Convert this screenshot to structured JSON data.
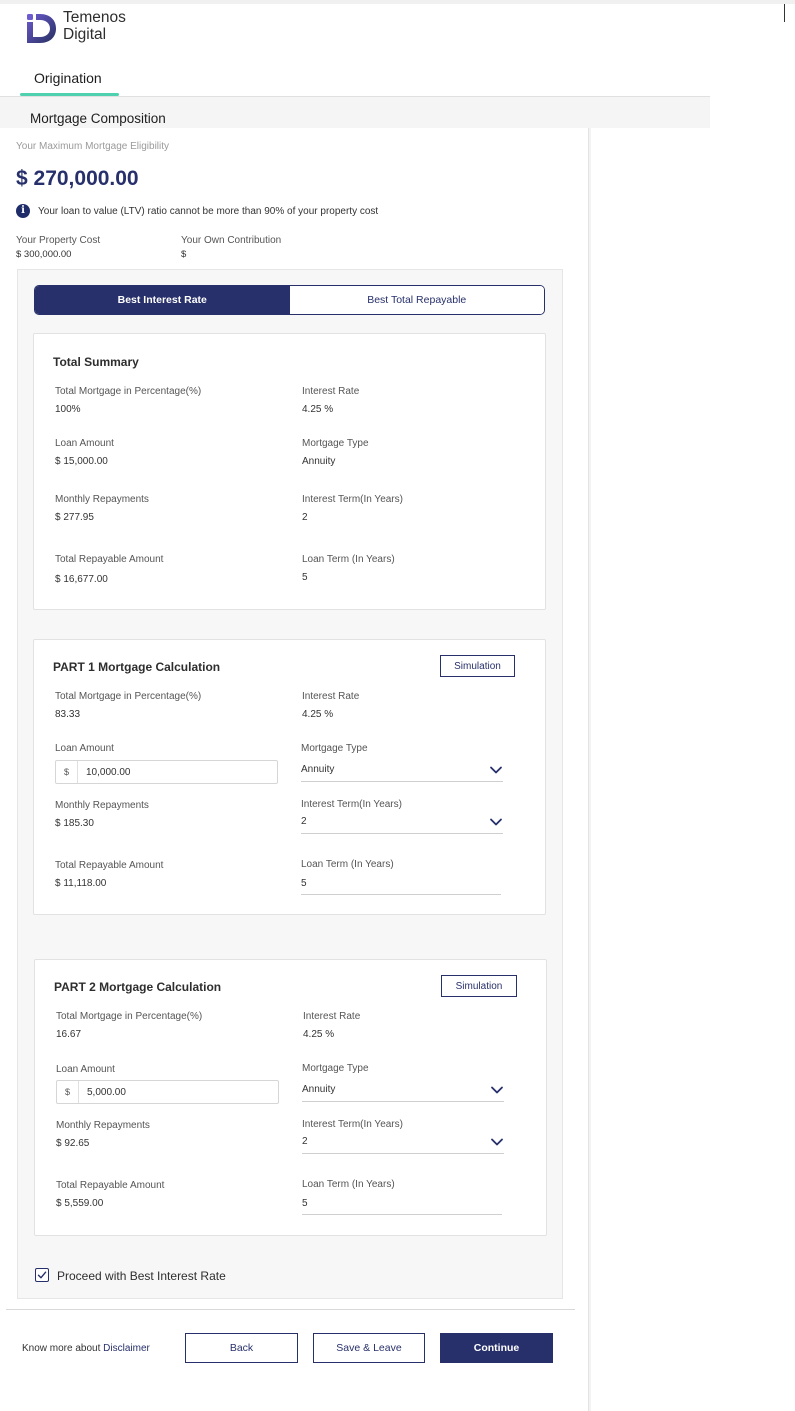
{
  "brand": {
    "name_line1": "Temenos",
    "name_line2": "Digital"
  },
  "nav": {
    "active_tab": "Origination"
  },
  "section": {
    "title": "Mortgage Composition"
  },
  "eligibility": {
    "label": "Your Maximum Mortgage Eligibility",
    "amount": "$ 270,000.00",
    "ltv_note": "Your loan to value (LTV) ratio cannot be more than 90% of your property cost",
    "property_cost_label": "Your Property Cost",
    "property_cost_value": "$ 300,000.00",
    "own_contribution_label": "Your Own Contribution",
    "own_contribution_value": "$"
  },
  "toggle": {
    "best_interest": "Best Interest Rate",
    "best_total": "Best Total Repayable"
  },
  "summary": {
    "title": "Total Summary",
    "total_pct_label": "Total Mortgage in Percentage(%)",
    "total_pct_value": "100%",
    "interest_rate_label": "Interest Rate",
    "interest_rate_value": "4.25 %",
    "loan_amount_label": "Loan Amount",
    "loan_amount_value": "$ 15,000.00",
    "mortgage_type_label": "Mortgage Type",
    "mortgage_type_value": "Annuity",
    "monthly_label": "Monthly Repayments",
    "monthly_value": "$ 277.95",
    "interest_term_label": "Interest Term(In Years)",
    "interest_term_value": "2",
    "total_repayable_label": "Total Repayable Amount",
    "total_repayable_value": "$ 16,677.00",
    "loan_term_label": "Loan Term (In Years)",
    "loan_term_value": "5"
  },
  "part1": {
    "title": "PART 1 Mortgage Calculation",
    "simulation": "Simulation",
    "total_pct_label": "Total Mortgage in Percentage(%)",
    "total_pct_value": "83.33",
    "interest_rate_label": "Interest Rate",
    "interest_rate_value": "4.25 %",
    "loan_amount_label": "Loan Amount",
    "currency": "$",
    "loan_amount_input": "10,000.00",
    "mortgage_type_label": "Mortgage Type",
    "mortgage_type_value": "Annuity",
    "monthly_label": "Monthly Repayments",
    "monthly_value": "$ 185.30",
    "interest_term_label": "Interest Term(In Years)",
    "interest_term_value": "2",
    "total_repayable_label": "Total Repayable Amount",
    "total_repayable_value": "$ 11,118.00",
    "loan_term_label": "Loan Term (In Years)",
    "loan_term_value": "5"
  },
  "part2": {
    "title": "PART 2 Mortgage Calculation",
    "simulation": "Simulation",
    "total_pct_label": "Total Mortgage in Percentage(%)",
    "total_pct_value": "16.67",
    "interest_rate_label": "Interest Rate",
    "interest_rate_value": "4.25 %",
    "loan_amount_label": "Loan Amount",
    "currency": "$",
    "loan_amount_input": "5,000.00",
    "mortgage_type_label": "Mortgage Type",
    "mortgage_type_value": "Annuity",
    "monthly_label": "Monthly Repayments",
    "monthly_value": "$ 92.65",
    "interest_term_label": "Interest Term(In Years)",
    "interest_term_value": "2",
    "total_repayable_label": "Total Repayable Amount",
    "total_repayable_value": "$ 5,559.00",
    "loan_term_label": "Loan Term (In Years)",
    "loan_term_value": "5"
  },
  "proceed": {
    "label": "Proceed with Best Interest Rate",
    "checked": true
  },
  "footer": {
    "know_more": "Know more about",
    "disclaimer": "Disclaimer",
    "back": "Back",
    "save_leave": "Save & Leave",
    "continue": "Continue"
  },
  "colors": {
    "primary": "#27306b",
    "accent": "#4fd1b0"
  }
}
